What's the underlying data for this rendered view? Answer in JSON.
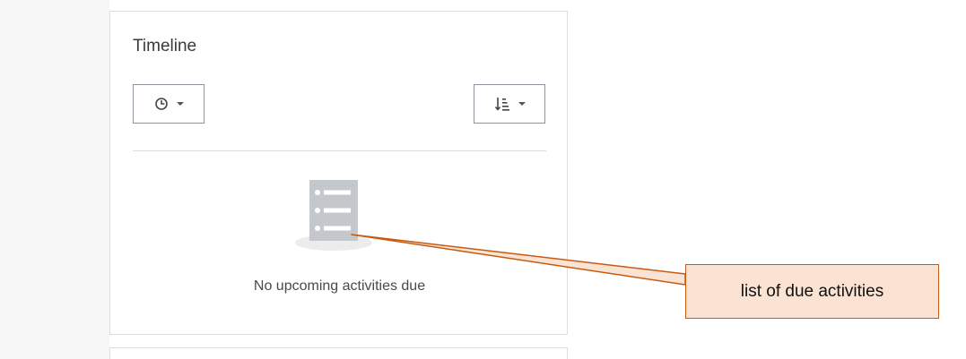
{
  "timeline": {
    "title": "Timeline",
    "filter_button": {
      "icon": "clock-icon"
    },
    "sort_button": {
      "icon": "sort-amount-icon"
    },
    "empty_state": {
      "icon": "list-icon",
      "message": "No upcoming activities due"
    }
  },
  "annotation": {
    "label": "list of due activities",
    "fill_color": "#fbe3d4",
    "border_color": "#c55a11"
  },
  "colors": {
    "text": "#3a3a3a",
    "border": "#dedede",
    "button_border": "#8f959e",
    "illustration": "#c4c7cc"
  }
}
